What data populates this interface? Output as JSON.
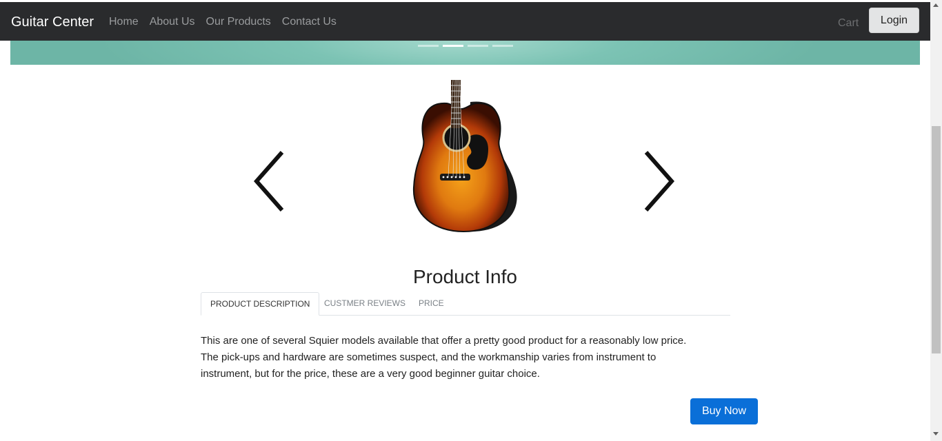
{
  "navbar": {
    "brand": "Guitar Center",
    "links": [
      "Home",
      "About Us",
      "Our Products",
      "Contact Us"
    ],
    "cart_label": "Cart",
    "login_label": "Login"
  },
  "banner": {
    "indicators": 4,
    "active_indicator": 2
  },
  "carousel": {
    "image": "acoustic-guitar-sunburst",
    "prev_icon": "chevron-left-icon",
    "next_icon": "chevron-right-icon"
  },
  "product": {
    "title": "Product Info",
    "tabs": [
      {
        "label": "PRODUCT DESCRIPTION",
        "active": true
      },
      {
        "label": "CUSTMER REVIEWS",
        "active": false
      },
      {
        "label": "PRICE",
        "active": false
      }
    ],
    "description_lines": [
      "This are one of several Squier models available that offer a pretty good product for a reasonably low price.",
      "The pick-ups and hardware are sometimes suspect, and the workmanship varies from instrument to",
      "instrument, but for the price, these are a very good beginner guitar choice."
    ],
    "buy_label": "Buy Now"
  },
  "colors": {
    "navbar_bg": "#2a2b2d",
    "banner": "#7cc3b4",
    "buy_button": "#0a6fd8"
  }
}
